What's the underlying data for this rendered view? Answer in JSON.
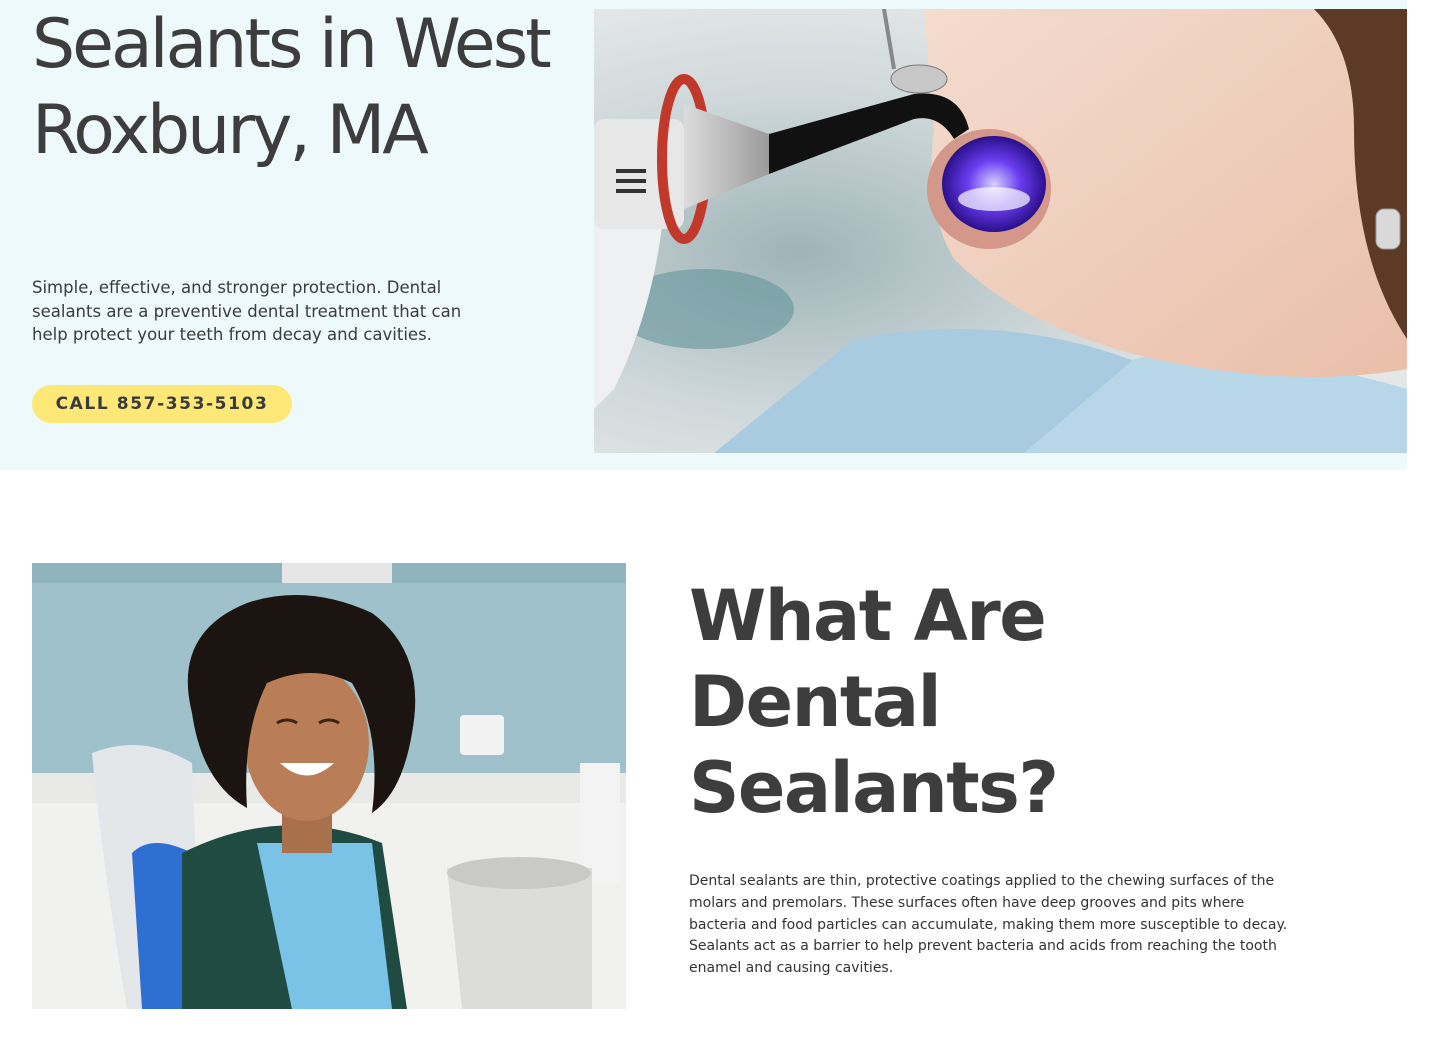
{
  "hero": {
    "title": "Sealants in West Roxbury, MA",
    "description": "Simple, effective, and stronger protection. Dental sealants are a preventive dental treatment that can help protect your teeth from decay and cavities.",
    "cta_label": "CALL 857-353-5103",
    "image_icon": "dental-curing-light-photo"
  },
  "section_what": {
    "title": "What Are Dental Sealants?",
    "body": "Dental sealants are thin, protective coatings applied to the chewing surfaces of the molars and premolars. These surfaces often have deep grooves and pits where bacteria and food particles can accumulate, making them more susceptible to decay. Sealants act as a barrier to help prevent bacteria and acids from reaching the tooth enamel and causing cavities.",
    "image_icon": "smiling-patient-photo"
  },
  "colors": {
    "hero_background": "#eef9fc",
    "cta_background": "#fde777",
    "heading": "#3d3d3d",
    "body_text": "#3b3b3b"
  }
}
